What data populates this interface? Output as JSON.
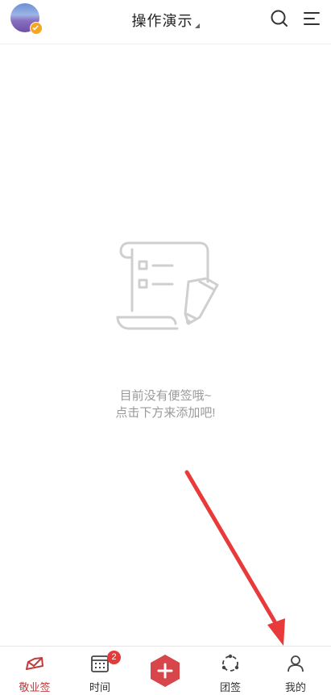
{
  "header": {
    "title": "操作演示",
    "avatar_icon": "avatar-image",
    "search_icon": "search-icon",
    "menu_icon": "menu-icon"
  },
  "empty_state": {
    "icon": "scroll-edit-icon",
    "line1": "目前没有便签哦~",
    "line2": "点击下方来添加吧!"
  },
  "tabbar": {
    "tabs": [
      {
        "label": "敬业签",
        "icon": "envelope-icon",
        "active": true
      },
      {
        "label": "时间",
        "icon": "calendar-icon",
        "badge": "2"
      },
      {
        "label": "",
        "icon": "plus-icon"
      },
      {
        "label": "团签",
        "icon": "team-icon"
      },
      {
        "label": "我的",
        "icon": "user-icon"
      }
    ]
  },
  "colors": {
    "accent": "#c23b3b",
    "arrow": "#e83a3a",
    "badge": "#e03c3c",
    "muted_text": "#9a9a9a"
  }
}
